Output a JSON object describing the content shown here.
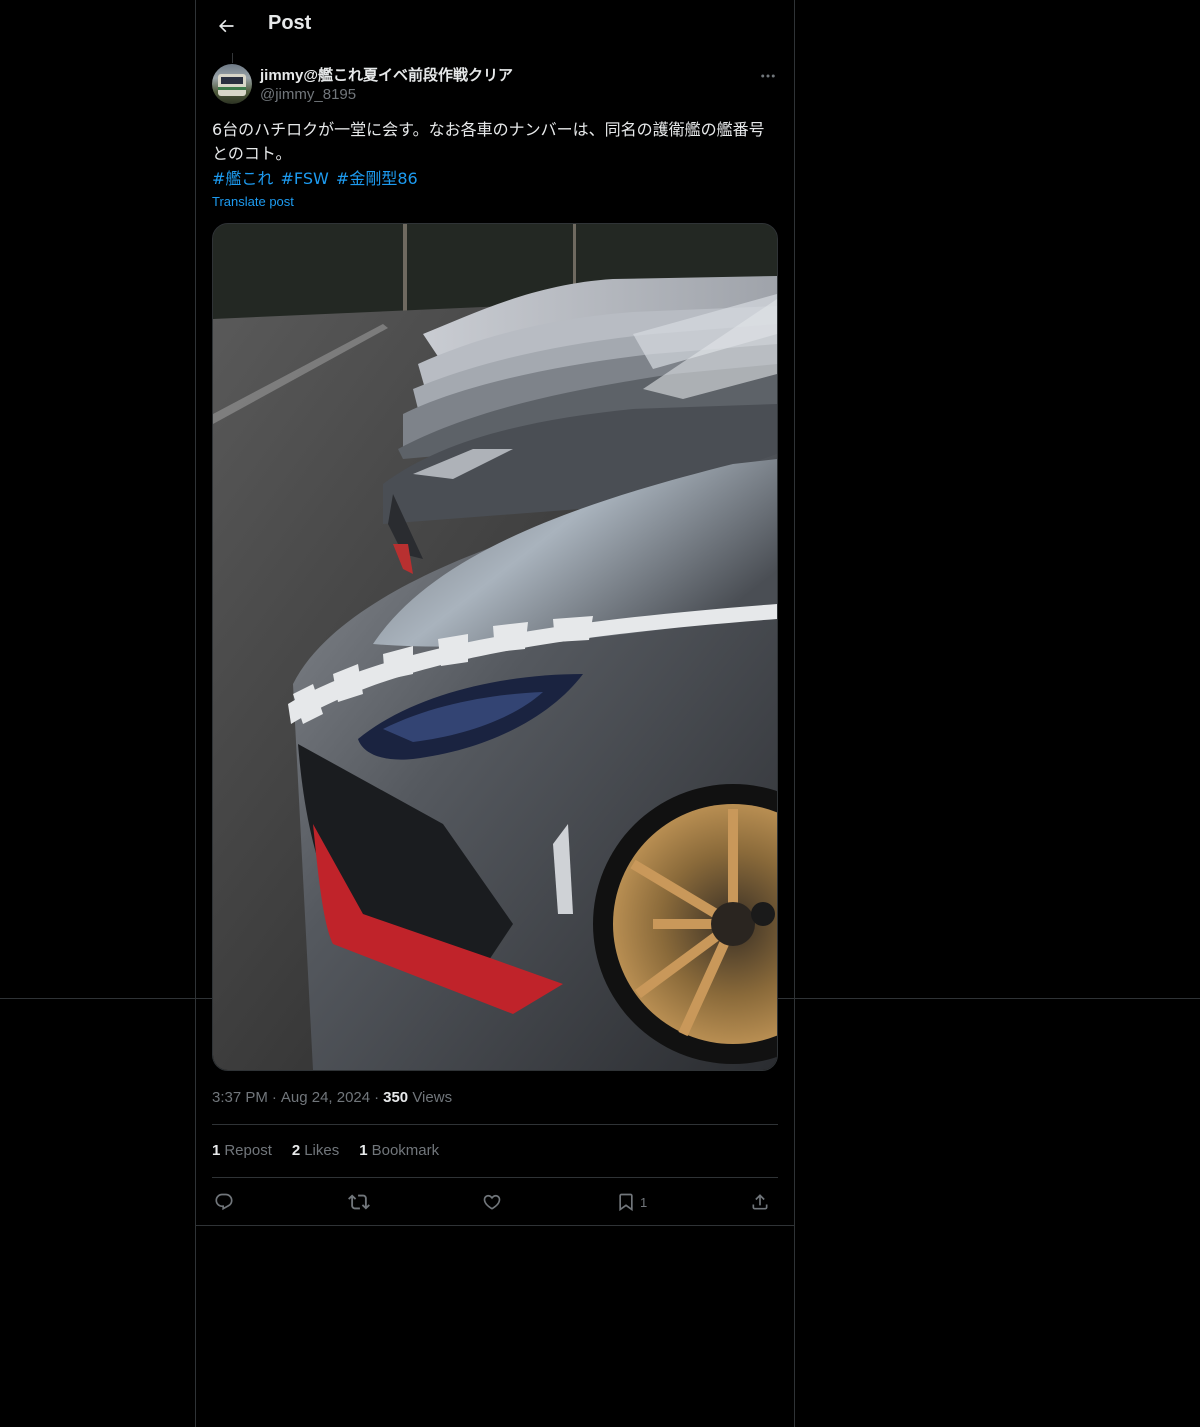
{
  "header": {
    "title": "Post",
    "back_icon": "arrow-left-icon"
  },
  "post": {
    "author": {
      "display_name": "jimmy@艦これ夏イベ前段作戦クリア",
      "handle": "@jimmy_8195"
    },
    "text": "6台のハチロクが一堂に会す。なお各車のナンバーは、同名の護衛艦の艦番号とのコト。",
    "hashtags": [
      "#艦これ",
      "#FSW",
      "#金剛型86"
    ],
    "translate_label": "Translate post",
    "media_alt": "Row of six grey Toyota GR86 cars with white hood decals and red front lips",
    "time": "3:37 PM",
    "date": "Aug 24, 2024",
    "views_count": "350",
    "views_label": "Views"
  },
  "stats": {
    "reposts_count": "1",
    "reposts_label": "Repost",
    "likes_count": "2",
    "likes_label": "Likes",
    "bookmarks_count": "1",
    "bookmarks_label": "Bookmark"
  },
  "actions": {
    "reply_icon": "reply-icon",
    "repost_icon": "repost-icon",
    "like_icon": "heart-icon",
    "bookmark_icon": "bookmark-icon",
    "bookmark_count": "1",
    "share_icon": "share-icon"
  },
  "colors": {
    "background": "#000000",
    "text": "#e7e9ea",
    "muted": "#71767b",
    "accent": "#1d9bf0",
    "border": "#2f3336"
  }
}
